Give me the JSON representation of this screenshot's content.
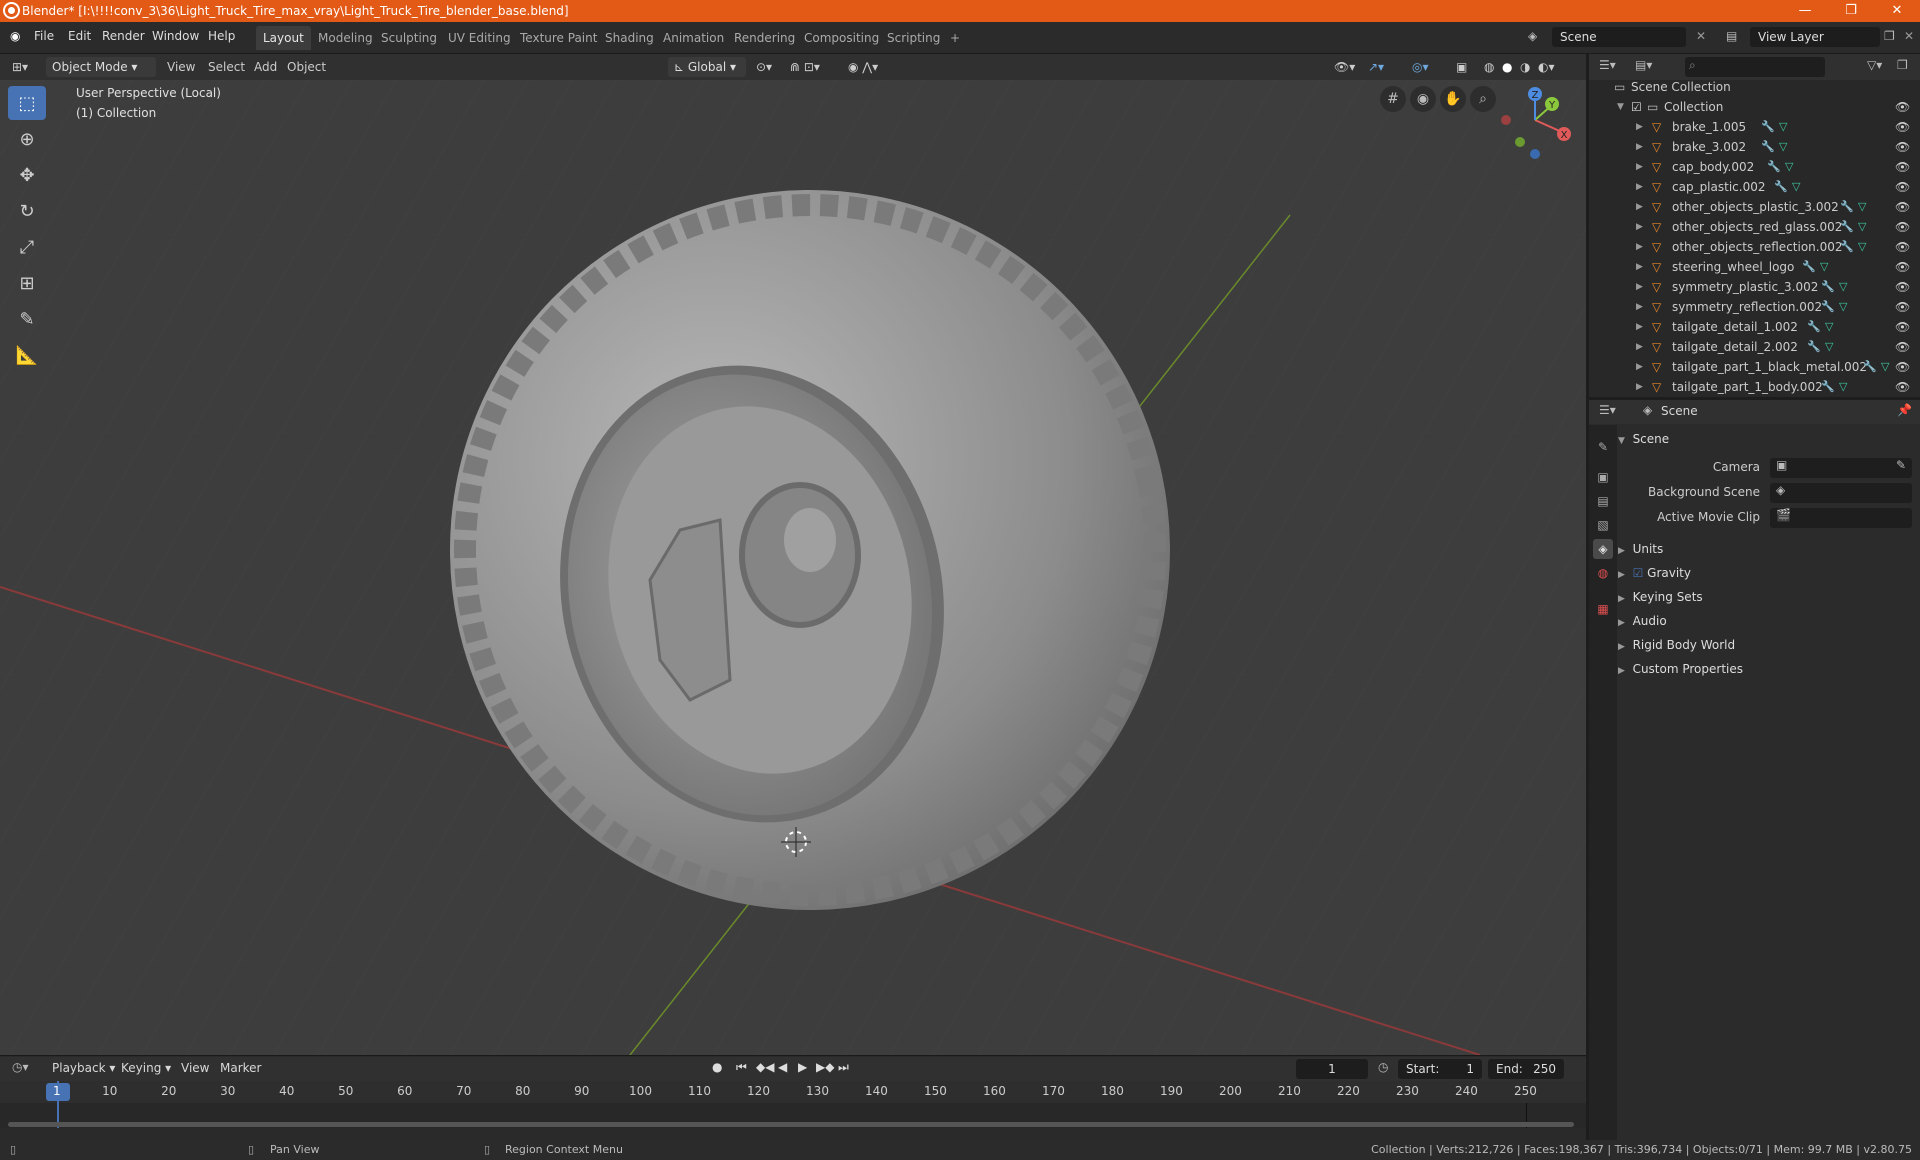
{
  "titlebar": {
    "title": "Blender* [I:\\!!!!conv_3\\36\\Light_Truck_Tire_max_vray\\Light_Truck_Tire_blender_base.blend]",
    "minimize": "—",
    "maximize": "❐",
    "close": "✕"
  },
  "menu": {
    "file": "File",
    "edit": "Edit",
    "render": "Render",
    "window": "Window",
    "help": "Help"
  },
  "workspaces": [
    "Layout",
    "Modeling",
    "Sculpting",
    "UV Editing",
    "Texture Paint",
    "Shading",
    "Animation",
    "Rendering",
    "Compositing",
    "Scripting"
  ],
  "add_workspace": "+",
  "scene": {
    "name": "Scene",
    "view_layer": "View Layer"
  },
  "viewport_header": {
    "mode": "Object Mode",
    "view": "View",
    "select": "Select",
    "add": "Add",
    "object": "Object",
    "orientation": "Global"
  },
  "viewport": {
    "perspective": "User Perspective (Local)",
    "collection": "(1) Collection"
  },
  "gizmo": {
    "x": "X",
    "y": "Y",
    "z": "Z"
  },
  "outliner": {
    "search_placeholder": "",
    "root": "Scene Collection",
    "collection": "Collection",
    "items": [
      "brake_1.005",
      "brake_3.002",
      "cap_body.002",
      "cap_plastic.002",
      "other_objects_plastic_3.002",
      "other_objects_red_glass.002",
      "other_objects_reflection.002",
      "steering_wheel_logo",
      "symmetry_plastic_3.002",
      "symmetry_reflection.002",
      "tailgate_detail_1.002",
      "tailgate_detail_2.002",
      "tailgate_part_1_black_metal.002",
      "tailgate_part_1_body.002"
    ]
  },
  "properties": {
    "header": "Scene",
    "section": "Scene",
    "camera_label": "Camera",
    "background_label": "Background Scene",
    "movieclip_label": "Active Movie Clip",
    "panels": [
      "Units",
      "Gravity",
      "Keying Sets",
      "Audio",
      "Rigid Body World",
      "Custom Properties"
    ]
  },
  "timeline": {
    "playback": "Playback",
    "keying": "Keying",
    "view": "View",
    "marker": "Marker",
    "current_frame": "1",
    "start_label": "Start:",
    "start": "1",
    "end_label": "End:",
    "end": "250",
    "ticks": [
      "1",
      "10",
      "20",
      "30",
      "40",
      "50",
      "60",
      "70",
      "80",
      "90",
      "100",
      "110",
      "120",
      "130",
      "140",
      "150",
      "160",
      "170",
      "180",
      "190",
      "200",
      "210",
      "220",
      "230",
      "240",
      "250"
    ]
  },
  "statusbar": {
    "pan": "Pan View",
    "context": "Region Context Menu",
    "stats": "Collection | Verts:212,726 | Faces:198,367 | Tris:396,734 | Objects:0/71 | Mem: 99.7 MB | v2.80.75"
  },
  "colors": {
    "accent": "#4772b3",
    "title": "#e25a15",
    "object_icon": "#e8892b"
  }
}
